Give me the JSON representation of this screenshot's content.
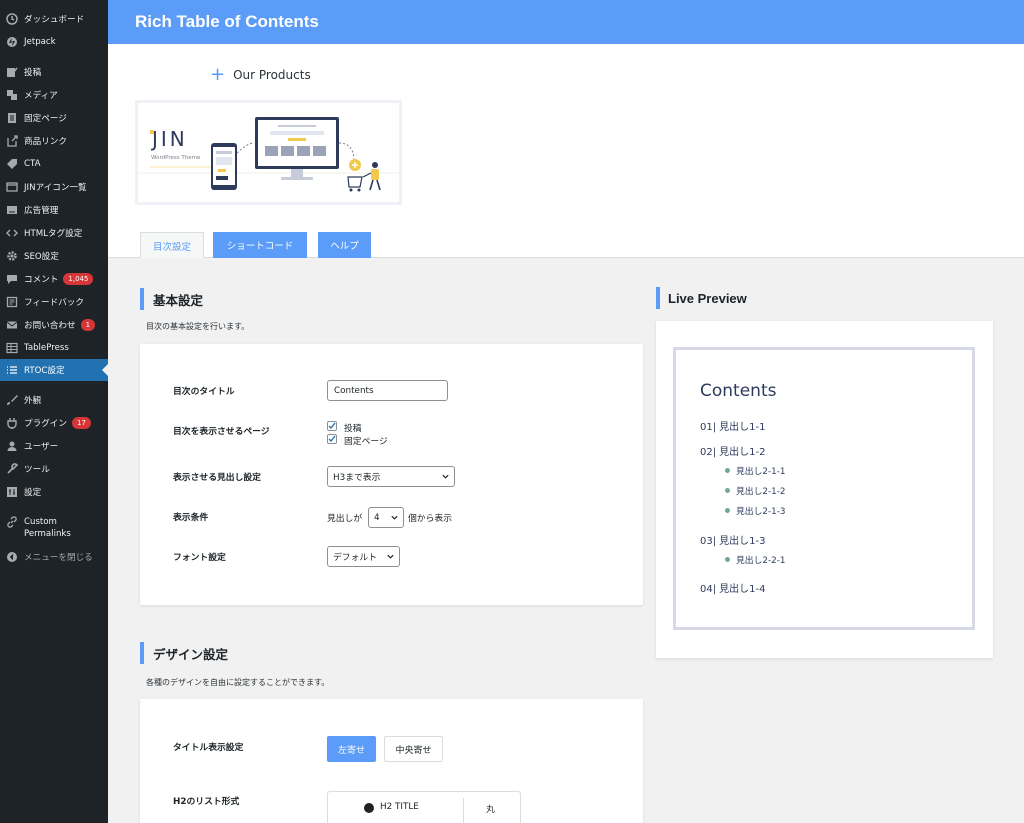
{
  "sidebar": {
    "items": [
      {
        "label": "ダッシュボード",
        "icon": "dashboard-icon"
      },
      {
        "label": "Jetpack",
        "icon": "jetpack-icon"
      },
      {
        "label": "投稿",
        "icon": "post-icon"
      },
      {
        "label": "メディア",
        "icon": "media-icon"
      },
      {
        "label": "固定ページ",
        "icon": "page-icon"
      },
      {
        "label": "商品リンク",
        "icon": "product-link-icon"
      },
      {
        "label": "CTA",
        "icon": "tag-icon"
      },
      {
        "label": "JINアイコン一覧",
        "icon": "icon-list-icon"
      },
      {
        "label": "広告管理",
        "icon": "ad-icon"
      },
      {
        "label": "HTMLタグ設定",
        "icon": "code-icon"
      },
      {
        "label": "SEO設定",
        "icon": "gear-icon"
      },
      {
        "label": "コメント",
        "icon": "comment-icon",
        "badge": "1,045"
      },
      {
        "label": "フィードバック",
        "icon": "feedback-icon"
      },
      {
        "label": "お問い合わせ",
        "icon": "mail-icon",
        "badge": "1"
      },
      {
        "label": "TablePress",
        "icon": "table-icon"
      },
      {
        "label": "RTOC設定",
        "icon": "list-icon",
        "active": true
      },
      {
        "label": "外観",
        "icon": "brush-icon"
      },
      {
        "label": "プラグイン",
        "icon": "plugin-icon",
        "badge": "17"
      },
      {
        "label": "ユーザー",
        "icon": "user-icon"
      },
      {
        "label": "ツール",
        "icon": "wrench-icon"
      },
      {
        "label": "設定",
        "icon": "settings-icon"
      },
      {
        "label": "Custom Permalinks",
        "icon": "link-icon"
      },
      {
        "label": "メニューを閉じる",
        "icon": "collapse-icon"
      }
    ]
  },
  "header": {
    "title": "Rich Table of Contents"
  },
  "products": {
    "label": "Our Products"
  },
  "banner": {
    "logo": "JIN",
    "subtitle": "WordPress Theme"
  },
  "tabs": {
    "toc": "目次設定",
    "shortcode": "ショートコード",
    "help": "ヘルプ"
  },
  "basic": {
    "title": "基本設定",
    "desc": "目次の基本設定を行います。",
    "toc_title_label": "目次のタイトル",
    "toc_title_value": "Contents",
    "pages_label": "目次を表示させるページ",
    "pages_opt1": "投稿",
    "pages_opt2": "固定ページ",
    "heading_label": "表示させる見出し設定",
    "heading_value": "H3まで表示",
    "cond_label": "表示条件",
    "cond_prefix": "見出しが",
    "cond_value": "4",
    "cond_suffix": "個から表示",
    "font_label": "フォント設定",
    "font_value": "デフォルト"
  },
  "design": {
    "title": "デザイン設定",
    "desc": "各種のデザインを自由に設定することができます。",
    "title_pos_label": "タイトル表示設定",
    "btn_left": "左寄せ",
    "btn_center": "中央寄せ",
    "h2_label": "H2のリスト形式",
    "h2_sample": "H2 TITLE",
    "h2_option": "丸"
  },
  "preview": {
    "title": "Live Preview",
    "heading": "Contents",
    "items": [
      {
        "num": "01|",
        "text": "見出し1-1"
      },
      {
        "num": "02|",
        "text": "見出し1-2"
      },
      {
        "num": "03|",
        "text": "見出し1-3"
      },
      {
        "num": "04|",
        "text": "見出し1-4"
      }
    ],
    "sub": [
      "見出し2-1-1",
      "見出し2-1-2",
      "見出し2-1-3",
      "見出し2-2-1"
    ]
  },
  "colors": {
    "accent": "#5a9cf8",
    "sidebar": "#1d2327",
    "active": "#2271b1",
    "badge": "#d63638",
    "preview_text": "#2e3a5c"
  }
}
